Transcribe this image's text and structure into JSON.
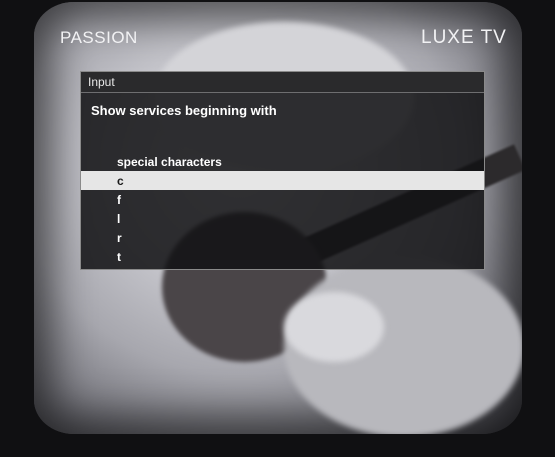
{
  "overlay": {
    "channel_name": "PASSION",
    "provider_logo": "LUXE TV"
  },
  "dialog": {
    "title": "Input",
    "prompt": "Show services beginning with",
    "choices": [
      "special characters",
      "c",
      "f",
      "l",
      "r",
      "t"
    ],
    "selected_index": 1
  }
}
